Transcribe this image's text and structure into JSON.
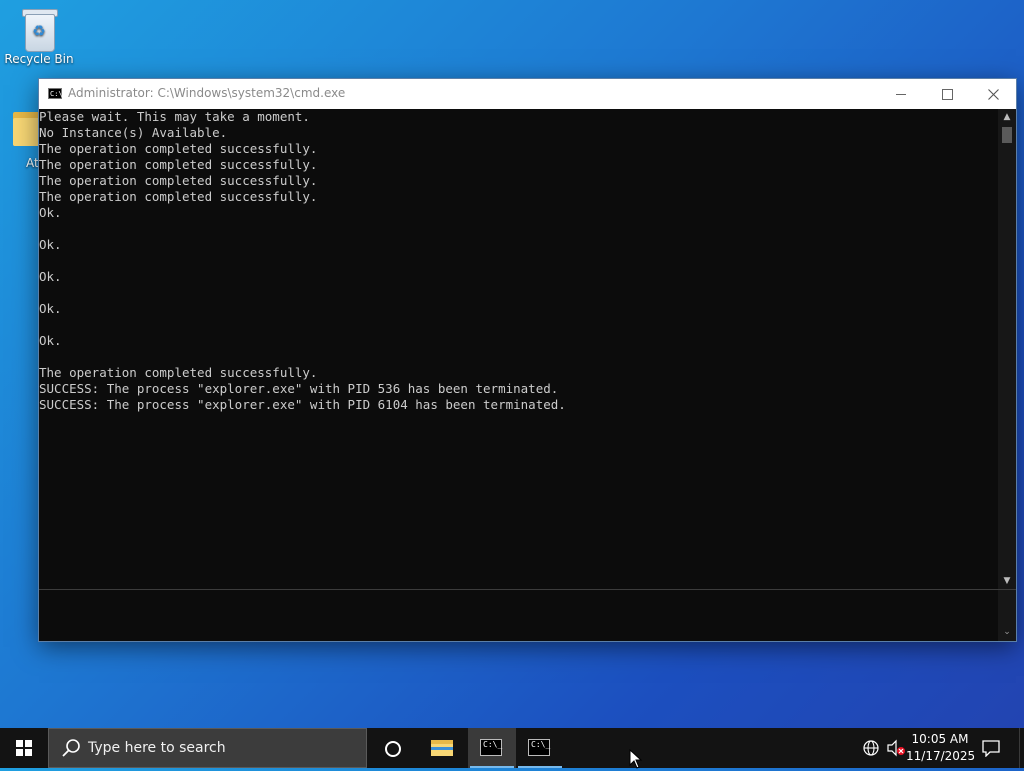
{
  "desktop": {
    "recycle_bin_label": "Recycle Bin",
    "folder_label_fragment": "At"
  },
  "window": {
    "title": "Administrator: C:\\Windows\\system32\\cmd.exe",
    "icon_text": "C:\\",
    "console_lines": [
      "Please wait. This may take a moment.",
      "No Instance(s) Available.",
      "The operation completed successfully.",
      "The operation completed successfully.",
      "The operation completed successfully.",
      "The operation completed successfully.",
      "Ok.",
      "",
      "Ok.",
      "",
      "Ok.",
      "",
      "Ok.",
      "",
      "Ok.",
      "",
      "The operation completed successfully.",
      "SUCCESS: The process \"explorer.exe\" with PID 536 has been terminated.",
      "SUCCESS: The process \"explorer.exe\" with PID 6104 has been terminated."
    ]
  },
  "taskbar": {
    "search_placeholder": "Type here to search",
    "cmd_icon_text": "C:\\_",
    "clock_time": "10:05 AM",
    "clock_date": "11/17/2025"
  },
  "colors": {
    "console_bg": "#0c0c0c",
    "console_text": "#cccccc",
    "taskbar_bg": "#131313",
    "active_indicator": "#76b9ed"
  }
}
